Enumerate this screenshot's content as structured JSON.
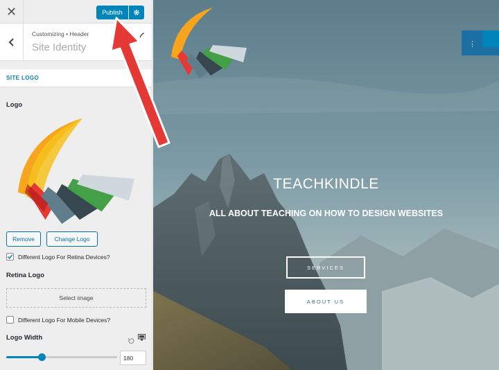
{
  "topbar": {
    "close_glyph": "✕",
    "publish_label": "Publish",
    "publish_settings_icon": "gear-icon"
  },
  "header": {
    "breadcrumb": "Customizing • Header",
    "title": "Site Identity",
    "back_icon": "chevron-left-icon",
    "help_icon": "help-icon"
  },
  "site_logo_section": {
    "label": "SITE LOGO",
    "logo_label": "Logo",
    "remove_label": "Remove",
    "change_label": "Change Logo",
    "retina_checkbox": {
      "label": "Different Logo For Retina Devices?",
      "checked": true
    },
    "retina_logo_label": "Retina Logo",
    "select_image_label": "Select image",
    "mobile_checkbox": {
      "label": "Different Logo For Mobile Devices?",
      "checked": false
    },
    "logo_width_label": "Logo Width",
    "logo_width_value": "180",
    "logo_width_slider_fraction": 0.32,
    "reset_icon": "reset-icon",
    "device_icon": "monitor-icon"
  },
  "preview": {
    "site_title": "TEACHKINDLE",
    "tagline": "ALL ABOUT TEACHING ON HOW TO DESIGN WEBSITES",
    "services_label": "SERVICES",
    "about_label": "ABOUT US",
    "edit_menu_glyph": "⋮"
  },
  "colors": {
    "accent": "#0085ba",
    "annotation_arrow": "#e53935",
    "sky": "#6f8f9f"
  }
}
